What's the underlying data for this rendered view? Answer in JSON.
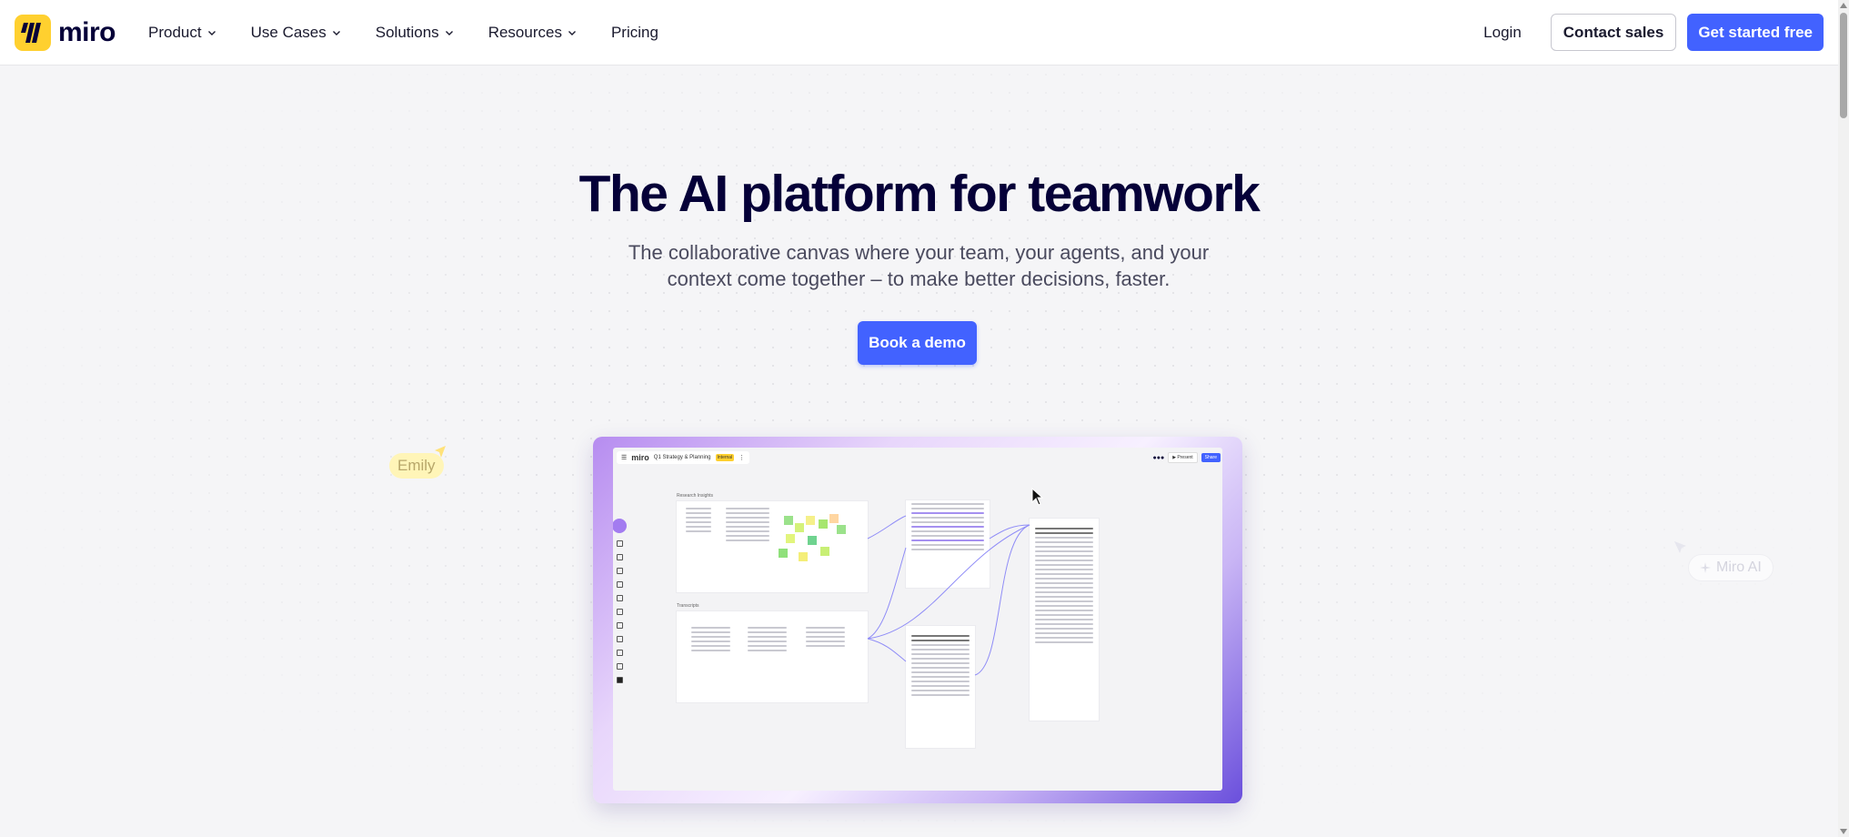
{
  "nav": {
    "logo_text": "miro",
    "menu": [
      {
        "label": "Product"
      },
      {
        "label": "Use Cases"
      },
      {
        "label": "Solutions"
      },
      {
        "label": "Resources"
      },
      {
        "label": "Pricing"
      }
    ],
    "login_label": "Login",
    "contact_label": "Contact sales",
    "get_started_label": "Get started free"
  },
  "hero": {
    "title": "The AI platform for teamwork",
    "subtitle": "The collaborative canvas where your team, your agents, and your context come together – to make better decisions, faster.",
    "cta_label": "Book a demo"
  },
  "cursors": {
    "emily": "Emily",
    "ai": "Miro AI"
  },
  "preview": {
    "app_logo": "miro",
    "board_name": "Q1 Strategy & Planning",
    "badge": "Internal",
    "present_label": "▶ Present",
    "share_label": "Share",
    "section_research": "Research Insights",
    "section_transcripts": "Transcripts"
  },
  "colors": {
    "primary": "#4262ff",
    "logo_yellow": "#ffd02f",
    "text_dark": "#050038"
  },
  "icons": [
    "chevron-down-icon",
    "miro-logo-icon",
    "cursor-arrow-icon",
    "ai-sparkle-icon"
  ]
}
